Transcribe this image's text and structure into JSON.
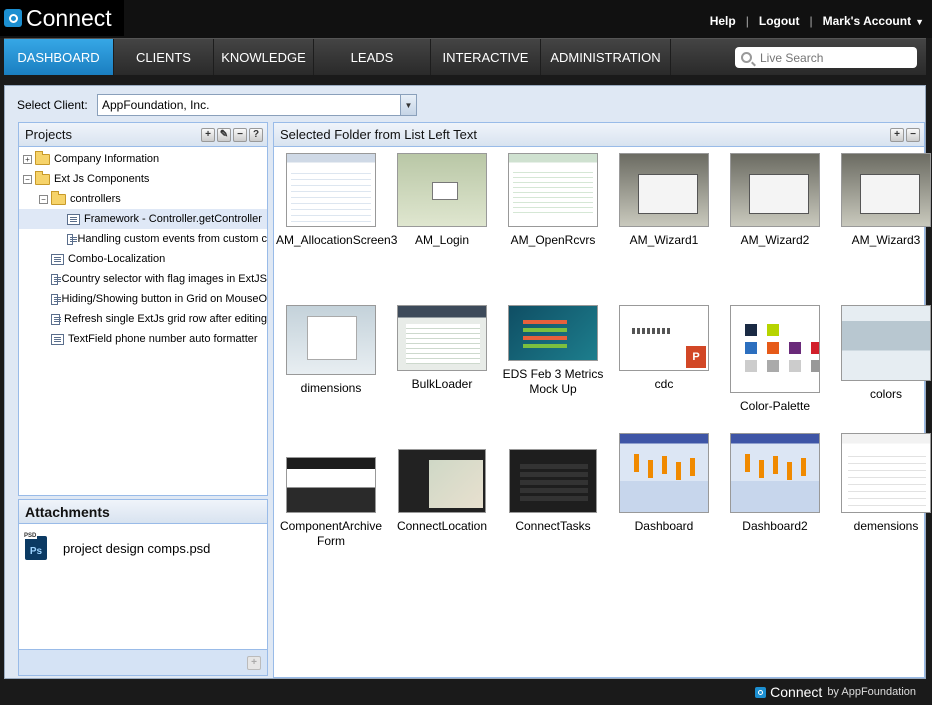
{
  "app": {
    "brand": "Connect"
  },
  "toplinks": {
    "help": "Help",
    "logout": "Logout",
    "account": "Mark's Account",
    "sep": "|"
  },
  "nav": {
    "tabs": [
      "DASHBOARD",
      "CLIENTS",
      "KNOWLEDGE",
      "LEADS",
      "INTERACTIVE",
      "ADMINISTRATION"
    ],
    "active": 0
  },
  "search": {
    "placeholder": "Live Search"
  },
  "client": {
    "label": "Select Client:",
    "value": "AppFoundation, Inc."
  },
  "projects": {
    "title": "Projects",
    "tools": [
      "+",
      "wrench",
      "−",
      "?"
    ],
    "items": [
      {
        "label": "Company Information",
        "type": "folder",
        "expander": "+"
      },
      {
        "label": "Ext Js Components",
        "type": "folder",
        "expander": "−"
      },
      {
        "label": "controllers",
        "type": "folder",
        "expander": "−"
      },
      {
        "label": "Framework - Controller.getController",
        "type": "leaf"
      },
      {
        "label": "Handling custom events from custom c",
        "type": "leaf"
      },
      {
        "label": "Combo-Localization",
        "type": "leaf"
      },
      {
        "label": "Country selector with flag images in ExtJS",
        "type": "leaf"
      },
      {
        "label": "Hiding/Showing button in Grid on MouseO",
        "type": "leaf"
      },
      {
        "label": "Refresh single ExtJs grid row after editing",
        "type": "leaf"
      },
      {
        "label": "TextField phone number auto formatter",
        "type": "leaf"
      }
    ]
  },
  "attachments": {
    "title": "Attachments",
    "files": [
      {
        "name": "project design comps.psd",
        "icon": "photoshop-icon",
        "icon_label": "Ps"
      }
    ],
    "footer_tool": "+"
  },
  "gallery": {
    "title": "Selected Folder from List Left Text",
    "tools": [
      "+",
      "−"
    ],
    "items": [
      "AM_AllocationScreen3",
      "AM_Login",
      "AM_OpenRcvrs",
      "AM_Wizard1",
      "AM_Wizard2",
      "AM_Wizard3",
      "dimensions",
      "BulkLoader",
      "EDS Feb 3 Metrics Mock Up",
      "cdc",
      "Color-Palette",
      "colors",
      "ComponentArchive Form",
      "ConnectLocation",
      "ConnectTasks",
      "Dashboard",
      "Dashboard2",
      "demensions"
    ]
  },
  "footer": {
    "brand": "Connect",
    "by": "by AppFoundation"
  },
  "colors": {
    "accent": "#1c8fd1",
    "nav_active": "#2a96d6",
    "panel_bg": "#dfe8f4"
  }
}
